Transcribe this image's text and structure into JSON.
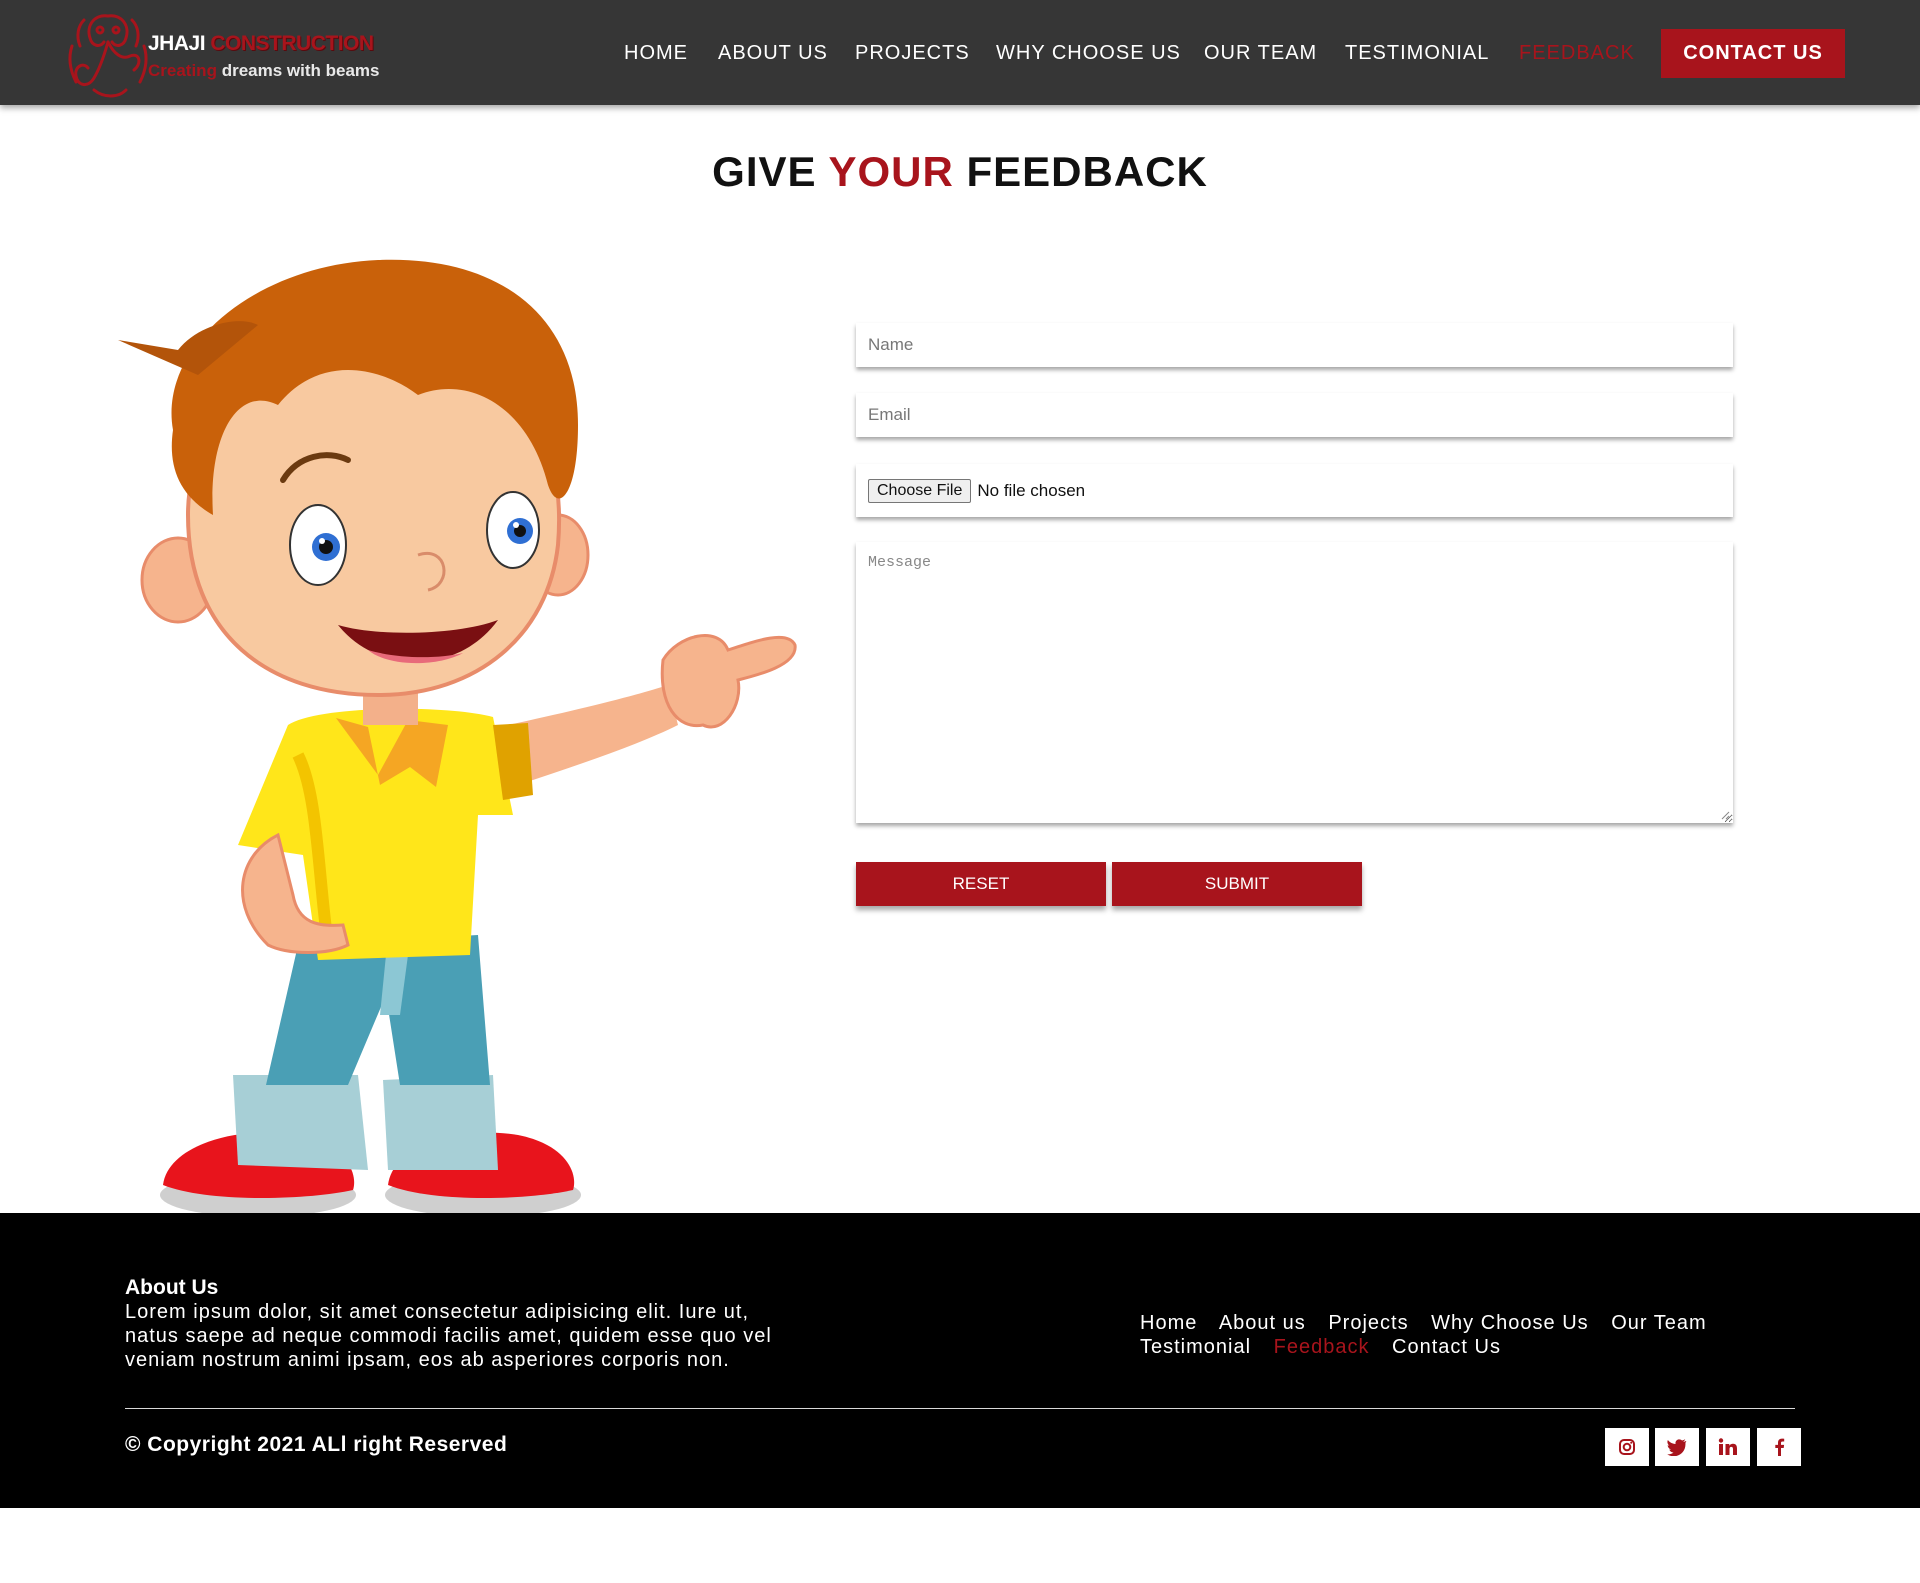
{
  "brand": {
    "name_part1": "JHAJI",
    "name_part2": "CONSTRUCTION",
    "tagline_part1": "Creating",
    "tagline_part2": "dreams with beams"
  },
  "nav": {
    "items": [
      {
        "label": "HOME",
        "active": false
      },
      {
        "label": "ABOUT US",
        "active": false
      },
      {
        "label": "PROJECTS",
        "active": false
      },
      {
        "label": "WHY CHOOSE US",
        "active": false
      },
      {
        "label": "OUR TEAM",
        "active": false
      },
      {
        "label": "TESTIMONIAL",
        "active": false
      },
      {
        "label": "FEEDBACK",
        "active": true
      }
    ],
    "contact_label": "CONTACT US"
  },
  "page": {
    "title_part1": "GIVE",
    "title_part2": "YOUR",
    "title_part3": "FEEDBACK"
  },
  "form": {
    "name_placeholder": "Name",
    "email_placeholder": "Email",
    "file_button_label": "Choose File",
    "file_status": "No file chosen",
    "message_placeholder": "Message",
    "reset_label": "RESET",
    "submit_label": "SUBMIT"
  },
  "footer": {
    "about_title": "About Us",
    "about_text": "Lorem ipsum dolor, sit amet consectetur adipisicing elit. Iure ut, natus saepe ad neque commodi facilis amet, quidem esse quo vel veniam nostrum animi ipsam, eos ab asperiores corporis non.",
    "links": [
      {
        "label": "Home",
        "active": false
      },
      {
        "label": "About us",
        "active": false
      },
      {
        "label": "Projects",
        "active": false
      },
      {
        "label": "Why Choose Us",
        "active": false
      },
      {
        "label": "Our Team",
        "active": false
      },
      {
        "label": "Testimonial",
        "active": false
      },
      {
        "label": "Feedback",
        "active": true
      },
      {
        "label": "Contact Us",
        "active": false
      }
    ],
    "copyright": "© Copyright 2021 ALl right Reserved",
    "social_icons": [
      "instagram-icon",
      "twitter-icon",
      "linkedin-icon",
      "facebook-icon"
    ]
  },
  "colors": {
    "accent": "#a8141c",
    "header_bg": "#363636",
    "footer_bg": "#000000"
  }
}
